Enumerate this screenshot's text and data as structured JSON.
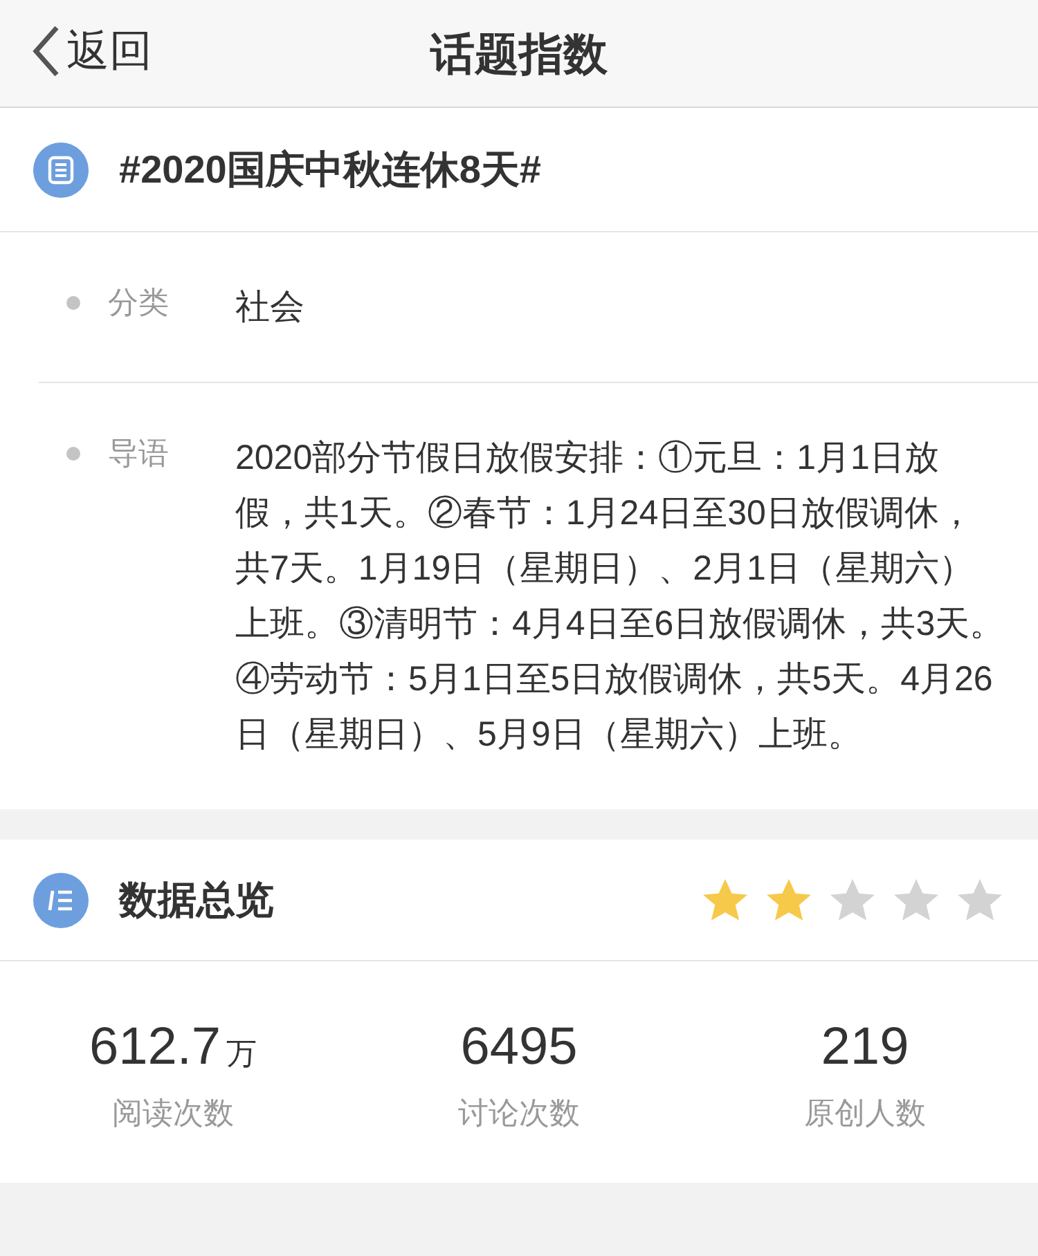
{
  "nav": {
    "back": "返回",
    "title": "话题指数"
  },
  "topic": {
    "title": "#2020国庆中秋连休8天#"
  },
  "details": [
    {
      "label": "分类",
      "value": "社会"
    },
    {
      "label": "导语",
      "value": "2020部分节假日放假安排：①元旦：1月1日放假，共1天。②春节：1月24日至30日放假调休，共7天。1月19日（星期日）、2月1日（星期六）上班。③清明节：4月4日至6日放假调休，共3天。④劳动节：5月1日至5日放假调休，共5天。4月26日（星期日）、5月9日（星期六）上班。"
    }
  ],
  "overview": {
    "title": "数据总览",
    "stars": 2,
    "stats": [
      {
        "value": "612.7",
        "unit": "万",
        "label": "阅读次数"
      },
      {
        "value": "6495",
        "label": "讨论次数"
      },
      {
        "value": "219",
        "label": "原创人数"
      }
    ]
  }
}
